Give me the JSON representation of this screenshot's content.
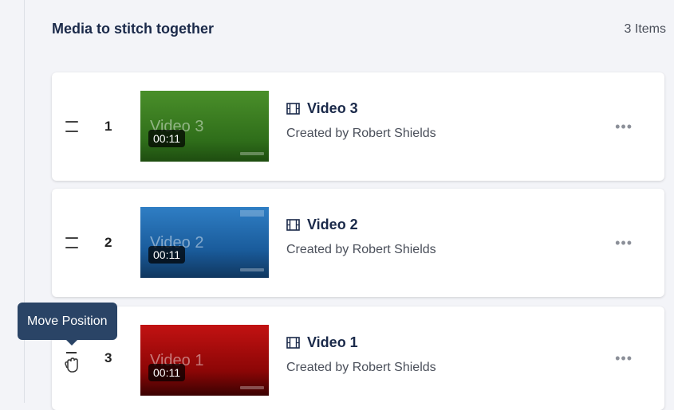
{
  "section": {
    "title": "Media to stitch together",
    "item_count": "3 Items"
  },
  "tooltip": "Move Position",
  "items": [
    {
      "position": "1",
      "thumbnail_text": "Video 3",
      "duration": "00:11",
      "title": "Video 3",
      "creator": "Created by Robert Shields",
      "thumb_color": "#3f7f24"
    },
    {
      "position": "2",
      "thumbnail_text": "Video 2",
      "duration": "00:11",
      "title": "Video 2",
      "creator": "Created by Robert Shields",
      "thumb_color": "#1f68ae"
    },
    {
      "position": "3",
      "thumbnail_text": "Video 1",
      "duration": "00:11",
      "title": "Video 1",
      "creator": "Created by Robert Shields",
      "thumb_color": "#b20d0d"
    }
  ],
  "icons": {
    "drag": "drag-handle-icon",
    "film": "film-icon",
    "more": "more-options-icon",
    "grab": "grab-hand-icon"
  },
  "more_glyph": "•••"
}
